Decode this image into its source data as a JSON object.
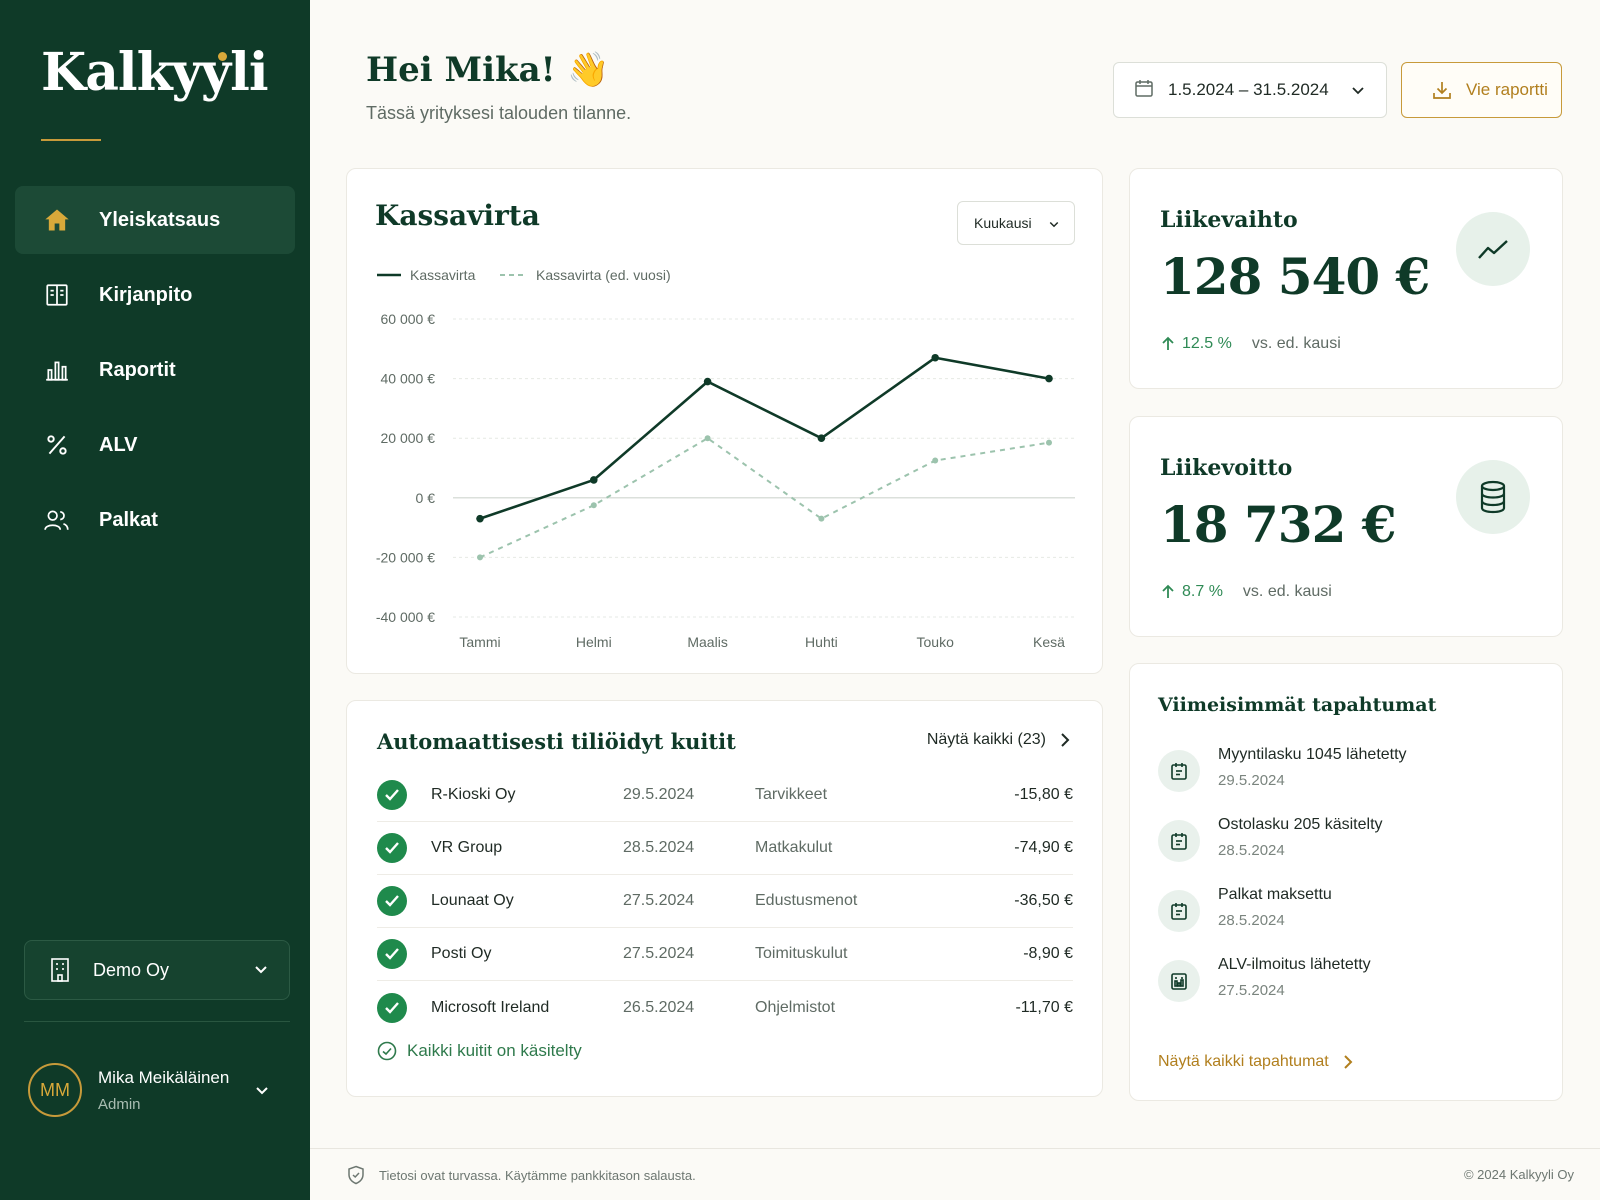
{
  "app": {
    "logo": "Kalkyyli",
    "brand_color": "#0f3a28",
    "accent_color": "#c79a3a"
  },
  "sidebar": {
    "items": [
      {
        "label": "Yleiskatsaus",
        "icon": "home-icon",
        "active": true
      },
      {
        "label": "Kirjanpito",
        "icon": "ledger-icon"
      },
      {
        "label": "Raportit",
        "icon": "bar-chart-icon"
      },
      {
        "label": "ALV",
        "icon": "percent-icon"
      },
      {
        "label": "Palkat",
        "icon": "users-icon"
      }
    ],
    "company": "Demo Oy",
    "user": {
      "initials": "MM",
      "name": "Mika Meikäläinen",
      "role": "Admin"
    }
  },
  "header": {
    "greeting": "Hei Mika! 👋",
    "subtitle": "Tässä yrityksesi talouden tilanne.",
    "date_range": "1.5.2024 – 31.5.2024",
    "export_label": "Vie raportti"
  },
  "cashflow": {
    "title": "Kassavirta",
    "period": "Kuukausi",
    "legend_current": "Kassavirta",
    "legend_previous": "Kassavirta (ed. vuosi)"
  },
  "chart_data": {
    "type": "line",
    "title": "Kassavirta",
    "categories": [
      "Tammi",
      "Helmi",
      "Maalis",
      "Huhti",
      "Touko",
      "Kesä"
    ],
    "series": [
      {
        "name": "Kassavirta",
        "values": [
          -7000,
          6000,
          39000,
          20000,
          47000,
          40000
        ],
        "color": "#0f3a28",
        "style": "solid"
      },
      {
        "name": "Kassavirta (ed. vuosi)",
        "values": [
          -20000,
          -2500,
          20000,
          -7000,
          12500,
          18500
        ],
        "color": "#9cc3ad",
        "style": "dashed"
      }
    ],
    "yticks": [
      "60 000 €",
      "40 000 €",
      "20 000 €",
      "0 €",
      "-20 000 €",
      "-40 000 €"
    ],
    "ytick_values": [
      60000,
      40000,
      20000,
      0,
      -20000,
      -40000
    ],
    "ylim": [
      -40000,
      60000
    ],
    "grid": true,
    "legend_position": "top-left"
  },
  "kpis": [
    {
      "title": "Liikevaihto",
      "value": "128 540 €",
      "delta": "12.5 %",
      "vs": "vs. ed. kausi",
      "icon": "trend-up-icon"
    },
    {
      "title": "Liikevoitto",
      "value": "18 732 €",
      "delta": "8.7 %",
      "vs": "vs. ed. kausi",
      "icon": "coins-icon"
    }
  ],
  "receipts": {
    "title": "Automaattisesti tiliöidyt kuitit",
    "show_all": "Näytä kaikki (23)",
    "rows": [
      {
        "name": "R-Kioski Oy",
        "date": "29.5.2024",
        "category": "Tarvikkeet",
        "amount": "-15,80 €"
      },
      {
        "name": "VR Group",
        "date": "28.5.2024",
        "category": "Matkakulut",
        "amount": "-74,90 €"
      },
      {
        "name": "Lounaat Oy",
        "date": "27.5.2024",
        "category": "Edustusmenot",
        "amount": "-36,50 €"
      },
      {
        "name": "Posti Oy",
        "date": "27.5.2024",
        "category": "Toimituskulut",
        "amount": "-8,90 €"
      },
      {
        "name": "Microsoft Ireland",
        "date": "26.5.2024",
        "category": "Ohjelmistot",
        "amount": "-11,70 €"
      }
    ],
    "footer": "Kaikki kuitit on käsitelty"
  },
  "events": {
    "title": "Viimeisimmät tapahtumat",
    "items": [
      {
        "name": "Myyntilasku 1045 lähetetty",
        "date": "29.5.2024",
        "icon": "invoice-icon"
      },
      {
        "name": "Ostolasku 205 käsitelty",
        "date": "28.5.2024",
        "icon": "invoice-icon"
      },
      {
        "name": "Palkat maksettu",
        "date": "28.5.2024",
        "icon": "invoice-icon"
      },
      {
        "name": "ALV-ilmoitus lähetetty",
        "date": "27.5.2024",
        "icon": "tax-report-icon"
      }
    ],
    "show_all": "Näytä kaikki tapahtumat"
  },
  "footer": {
    "security_note": "Tietosi ovat turvassa. Käytämme pankkitason salausta.",
    "copyright": "© 2024 Kalkyyli Oy"
  }
}
